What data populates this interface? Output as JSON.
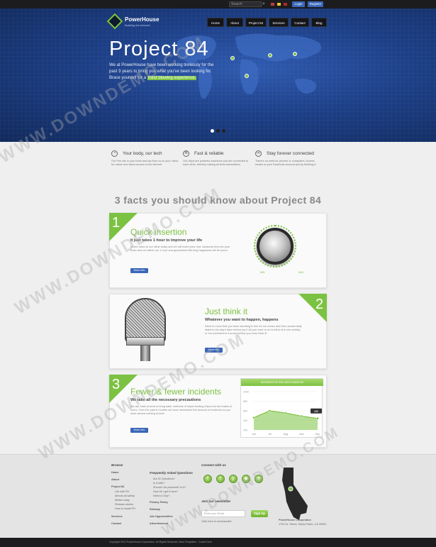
{
  "topbar": {
    "search_placeholder": "Search",
    "login_label": "Login",
    "register_label": "Register",
    "flag_colors": [
      "#c23b3b",
      "#e8c22e",
      "#b52828"
    ]
  },
  "header": {
    "brand": "PowerHouse",
    "tagline": "Building the Internet",
    "nav": [
      "Home",
      "About",
      "Project 84",
      "Services",
      "Contact",
      "Blog"
    ]
  },
  "hero": {
    "title": "Project 84",
    "text": "We at PowerHouse have been working tirelessly for the past 3 years to bring you what you've been looking for. Brace yourself for a",
    "highlight": "mind blowing experience."
  },
  "features": [
    {
      "icon": "globe-icon",
      "glyph": "◔",
      "title": "Your body, our tech",
      "text": "Our Pen sits in your brain and tap from us so your vision for nature and direct access to the internet."
    },
    {
      "icon": "wifi-icon",
      "glyph": "≋",
      "title": "Fast & reliable",
      "text": "Our chips are powerful machines and are connected to each other, thereby making all texts transmitters."
    },
    {
      "icon": "link-icon",
      "glyph": "∞",
      "title": "Stay forever connected",
      "text": "There's no need for phones or computers. Access emails or your Facebook account just by thinking it."
    }
  ],
  "facts_title": "3 facts you should know about Project 84",
  "cards": [
    {
      "num": "1",
      "title": "Quick insertion",
      "subtitle": "It just takes 1 hour to improve your life",
      "text": "Come down to our clinic today and we will insert your new Javascrip tiny into your brain and cut within our 1 hour and guaranteed life-long happiness will be yours.",
      "button": "More info"
    },
    {
      "num": "2",
      "title": "Just think it",
      "subtitle": "Whatever you want to happen, happens",
      "text": "Want to move that you were standing in line for ice cream and then accidentally listed to the day's fake behind you? All you have to do is think of a new activity or fun somewhere it prone before you even think it!",
      "button": "More info"
    },
    {
      "num": "3",
      "title": "Fewer & fewer incidents",
      "subtitle": "We take all the necessary precautions",
      "text": "We are hard at work to bring safer methods of implementing chips into the brains of users. Over the past 6 months we have diminished the amount of incidents so you have almost nothing to fear!",
      "button": "More info"
    }
  ],
  "knob": {
    "min_label": "MIN",
    "max_label": "MAX"
  },
  "chart_data": {
    "type": "area",
    "title": "INCIDENTS IN THE LAST 6 MONTHS",
    "categories": [
      "Jun",
      "Jul",
      "Aug",
      "Nov",
      "Dec"
    ],
    "values": [
      32,
      50,
      44,
      36,
      30
    ],
    "callout": "456",
    "ylabels": [
      "1000",
      "800",
      "600",
      "400",
      "200"
    ],
    "ylim": [
      0,
      100
    ],
    "color": "#7cc242",
    "grid": true
  },
  "footer": {
    "browse_heading": "Browse",
    "browse_links": [
      "Home",
      "About",
      "Project 84"
    ],
    "browse_sub": [
      "Life with PH",
      "Almost all safety",
      "Media today",
      "Release stories",
      "How to install PH"
    ],
    "browse_more": [
      "Services",
      "Contact"
    ],
    "faq_heading": "Frequently Asked Questions",
    "faq_items": [
      "Are ID Questions?",
      "Is it safe?",
      "Should I be paranoid? Is it?",
      "How do I get it here?",
      "Need a Chip?"
    ],
    "faq_links": [
      "Privacy Policy",
      "Sitemap",
      "Job Opportunities",
      "Advertisement"
    ],
    "connect_heading": "Connect with us",
    "social": [
      "f",
      "t",
      "y",
      "◉",
      "✉"
    ],
    "newsletter_heading": "Join our newsletter",
    "email_placeholder": "Enter your Email",
    "signup": "Sign Up",
    "newsletter_note": "Click here to unsubscribe",
    "address_name": "PowerHouse Corporation",
    "address": "1720 Dr. Street, Santa Fedro, CA 99922",
    "copyright": "Copyright 2012 PowerHouse Corporation. All Rights Reserved. Must Templates - Coded Dem"
  },
  "watermark": "WWW.DOWNDEMO.COM"
}
